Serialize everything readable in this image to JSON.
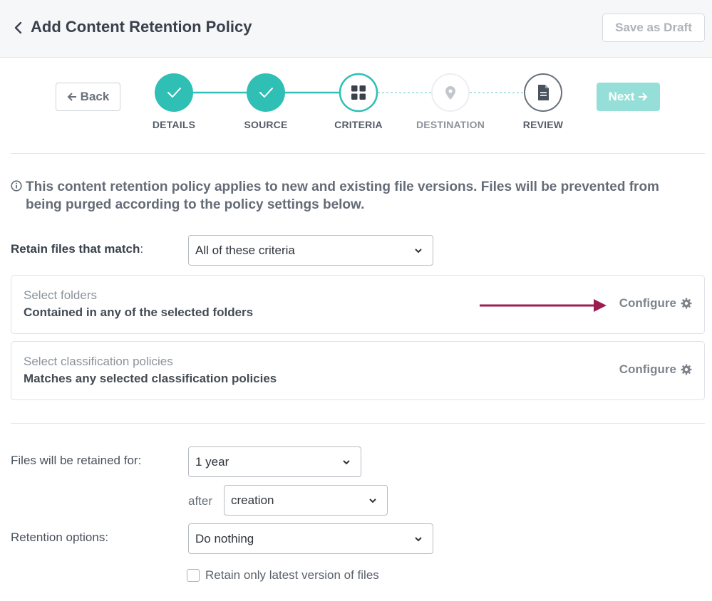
{
  "header": {
    "title": "Add Content Retention Policy",
    "save_draft_label": "Save as Draft"
  },
  "nav": {
    "back_label": "Back",
    "next_label": "Next"
  },
  "steps": [
    {
      "label": "DETAILS",
      "state": "complete"
    },
    {
      "label": "SOURCE",
      "state": "complete"
    },
    {
      "label": "CRITERIA",
      "state": "current"
    },
    {
      "label": "DESTINATION",
      "state": "upcoming"
    },
    {
      "label": "REVIEW",
      "state": "upcoming"
    }
  ],
  "info": {
    "text": "This content retention policy applies to new and existing file versions. Files will be prevented from being purged according to the policy settings below."
  },
  "criteria": {
    "match_label": "Retain files that match",
    "match_colon": ":",
    "match_value": "All of these criteria",
    "folders": {
      "sub": "Select folders",
      "main": "Contained in any of the selected folders",
      "configure_label": "Configure"
    },
    "classification": {
      "sub": "Select classification policies",
      "main": "Matches any selected classification policies",
      "configure_label": "Configure"
    }
  },
  "retention": {
    "retained_for_label": "Files will be retained for:",
    "duration_value": "1 year",
    "after_label": "after",
    "after_value": "creation",
    "options_label": "Retention options:",
    "options_value": "Do nothing",
    "latest_version_label": "Retain only latest version of files",
    "latest_version_checked": false
  },
  "colors": {
    "teal": "#2fbfb4",
    "teal_light": "#95dfd8",
    "annotation_arrow": "#9c1c4f"
  }
}
